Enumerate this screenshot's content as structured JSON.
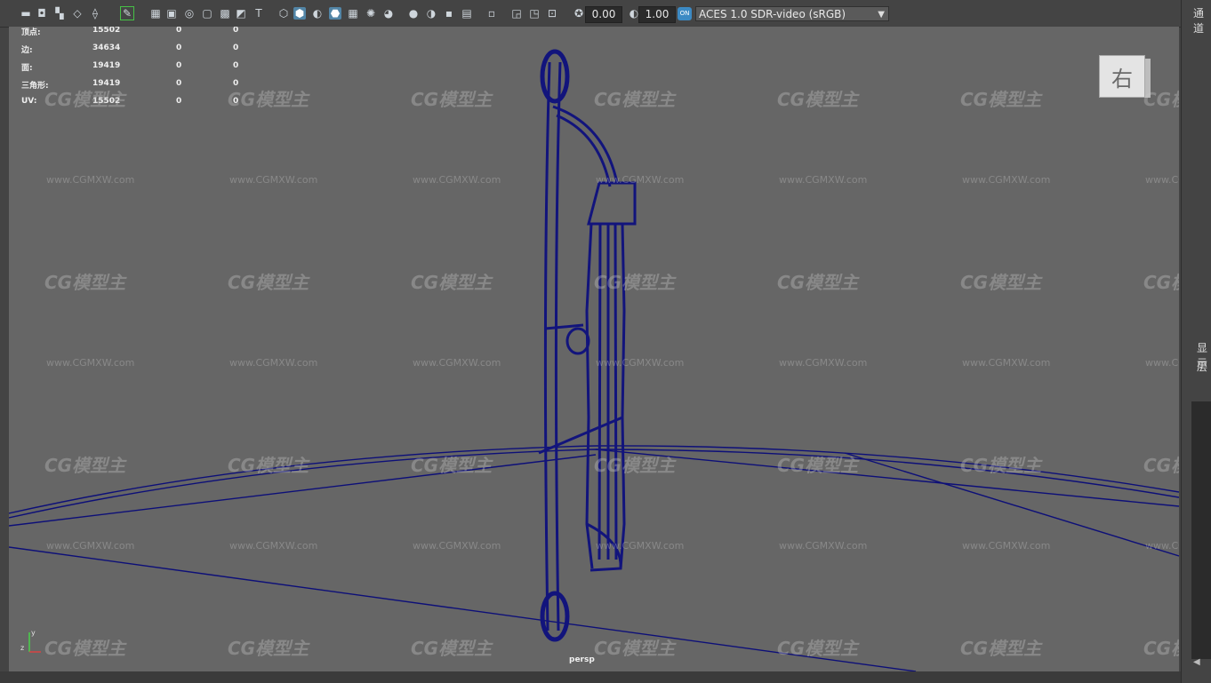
{
  "toolbar": {
    "exposure_value": "0.00",
    "gamma_value": "1.00",
    "color_space": "ACES 1.0 SDR-video (sRGB)",
    "icons": [
      "select-camera-icon",
      "camera-attributes-icon",
      "bookmark-icon",
      "image-plane-icon",
      "2d-pan-zoom-icon",
      "grease-pencil-icon",
      "grid-icon",
      "film-gate-icon",
      "resolution-gate-icon",
      "gate-mask-icon",
      "field-chart-icon",
      "safe-action-icon",
      "safe-title-icon",
      "wireframe-icon",
      "smooth-shade-icon",
      "default-material-icon",
      "wireframe-on-shaded-icon",
      "xray-icon",
      "use-lights-icon",
      "shadows-icon",
      "ambient-occlusion-icon",
      "motion-blur-icon",
      "anti-aliasing-icon",
      "depth-of-field-icon",
      "isolate-select-icon",
      "xray-joints-icon",
      "xray-active-icon",
      "backface-culling-icon",
      "exposure-icon",
      "gamma-icon",
      "color-management-icon"
    ]
  },
  "hud": {
    "rows": [
      {
        "label": "顶点:",
        "v1": "15502",
        "v2": "0",
        "v3": "0"
      },
      {
        "label": "边:",
        "v1": "34634",
        "v2": "0",
        "v3": "0"
      },
      {
        "label": "面:",
        "v1": "19419",
        "v2": "0",
        "v3": "0"
      },
      {
        "label": "三角形:",
        "v1": "19419",
        "v2": "0",
        "v3": "0"
      },
      {
        "label": "UV:",
        "v1": "15502",
        "v2": "0",
        "v3": "0"
      }
    ]
  },
  "view_cube": {
    "label": "右"
  },
  "camera_label": "persp",
  "axis": {
    "y": "y",
    "z": "z"
  },
  "watermark": {
    "logo": "CG模型主",
    "url": "www.CGMXW.com"
  },
  "right_panel": {
    "channel_tab": "通道",
    "display_tab": "显示",
    "layer_tab": "层"
  },
  "colors": {
    "wire": "#0d0f78",
    "viewport_bg": "#666666",
    "accent": "#5285a6"
  }
}
